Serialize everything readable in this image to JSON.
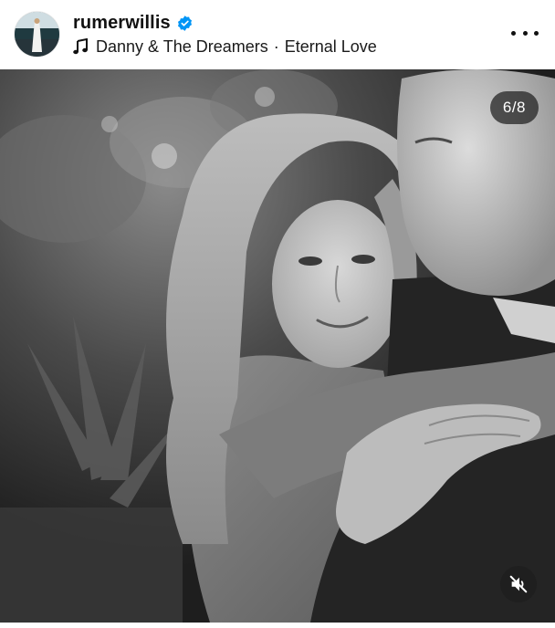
{
  "post": {
    "username": "rumerwillis",
    "verified": true,
    "music": {
      "artist": "Danny & The Dreamers",
      "separator": "·",
      "track": "Eternal Love"
    }
  },
  "media": {
    "counter": "6/8",
    "description_icon": "photo"
  },
  "icons": {
    "verified": "verified-badge-icon",
    "music": "music-note-icon",
    "more": "more-options-icon",
    "mute": "muted-speaker-icon"
  },
  "colors": {
    "verified_blue": "#0095f6",
    "text": "#111111",
    "overlay": "#1e1e1e"
  }
}
